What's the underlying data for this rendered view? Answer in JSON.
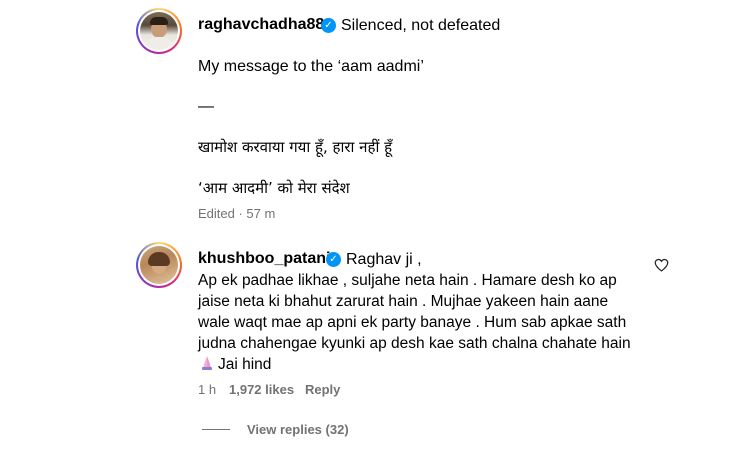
{
  "post": {
    "username": "raghavchadha88",
    "verified": true,
    "caption_first": "Silenced, not defeated",
    "line1": "My message to the ‘aam aadmi’",
    "separator": "—",
    "line2": "खामोश करवाया गया हूँ, हारा नहीं हूँ",
    "line3": "‘आम आदमी’ को मेरा संदेश",
    "edited_label": "Edited · 57 m"
  },
  "comment": {
    "username": "khushboo_patani",
    "verified": true,
    "first": "Raghav ji ,",
    "body_lines": [
      "Ap ek padhae likhae , suljahe neta hain . Hamare desh ko ap",
      "jaise neta ki bhahut zarurat hain . Mujhae yakeen hain aane",
      "wale waqt mae ap apni ek party banaye . Hum sab apkae sath",
      "judna chahengae kyunki ap desh kae sath chalna chahate hain",
      "Jai hind"
    ],
    "time": "1 h",
    "likes": "1,972 likes",
    "reply_label": "Reply",
    "view_replies": "View replies (32)",
    "emoji_icon": "folded-hands-emoji",
    "colors": {
      "verified": "#0095f6",
      "meta": "#737373"
    }
  }
}
